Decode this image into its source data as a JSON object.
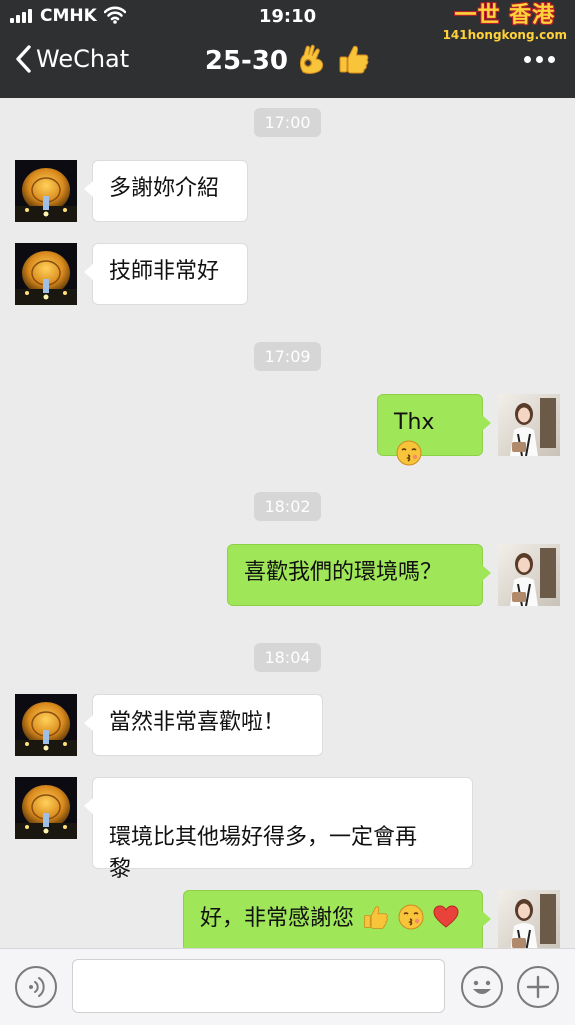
{
  "status_bar": {
    "carrier": "CMHK",
    "time": "19:10"
  },
  "watermark": {
    "title": "一世 香港",
    "url": "141hongkong.com"
  },
  "nav": {
    "back_label": "WeChat",
    "title": "25-30"
  },
  "messages": [
    {
      "type": "timestamp",
      "text": "17:00"
    },
    {
      "type": "received",
      "text": "多謝妳介紹"
    },
    {
      "type": "received",
      "text": "技師非常好"
    },
    {
      "type": "timestamp",
      "text": "17:09"
    },
    {
      "type": "sent",
      "text": "Thx"
    },
    {
      "type": "timestamp",
      "text": "18:02"
    },
    {
      "type": "sent",
      "text": "喜歡我們的環境嗎？"
    },
    {
      "type": "timestamp",
      "text": "18:04"
    },
    {
      "type": "received",
      "text": "當然非常喜歡啦！"
    },
    {
      "type": "received",
      "text": "環境比其他場好得多，一定會再\n黎"
    },
    {
      "type": "sent",
      "text": "好，非常感謝您"
    }
  ],
  "icons": [
    "signal-icon",
    "wifi-icon",
    "back-chevron-icon",
    "ok-hand-emoji",
    "thumbs-up-emoji",
    "more-icon",
    "kiss-emoji",
    "heart-emoji",
    "voice-icon",
    "smiley-icon",
    "plus-icon"
  ],
  "colors": {
    "nav_bg": "#2f3032",
    "sent_bubble": "#9fe658",
    "received_bubble": "#ffffff",
    "chat_bg": "#ebebeb"
  }
}
